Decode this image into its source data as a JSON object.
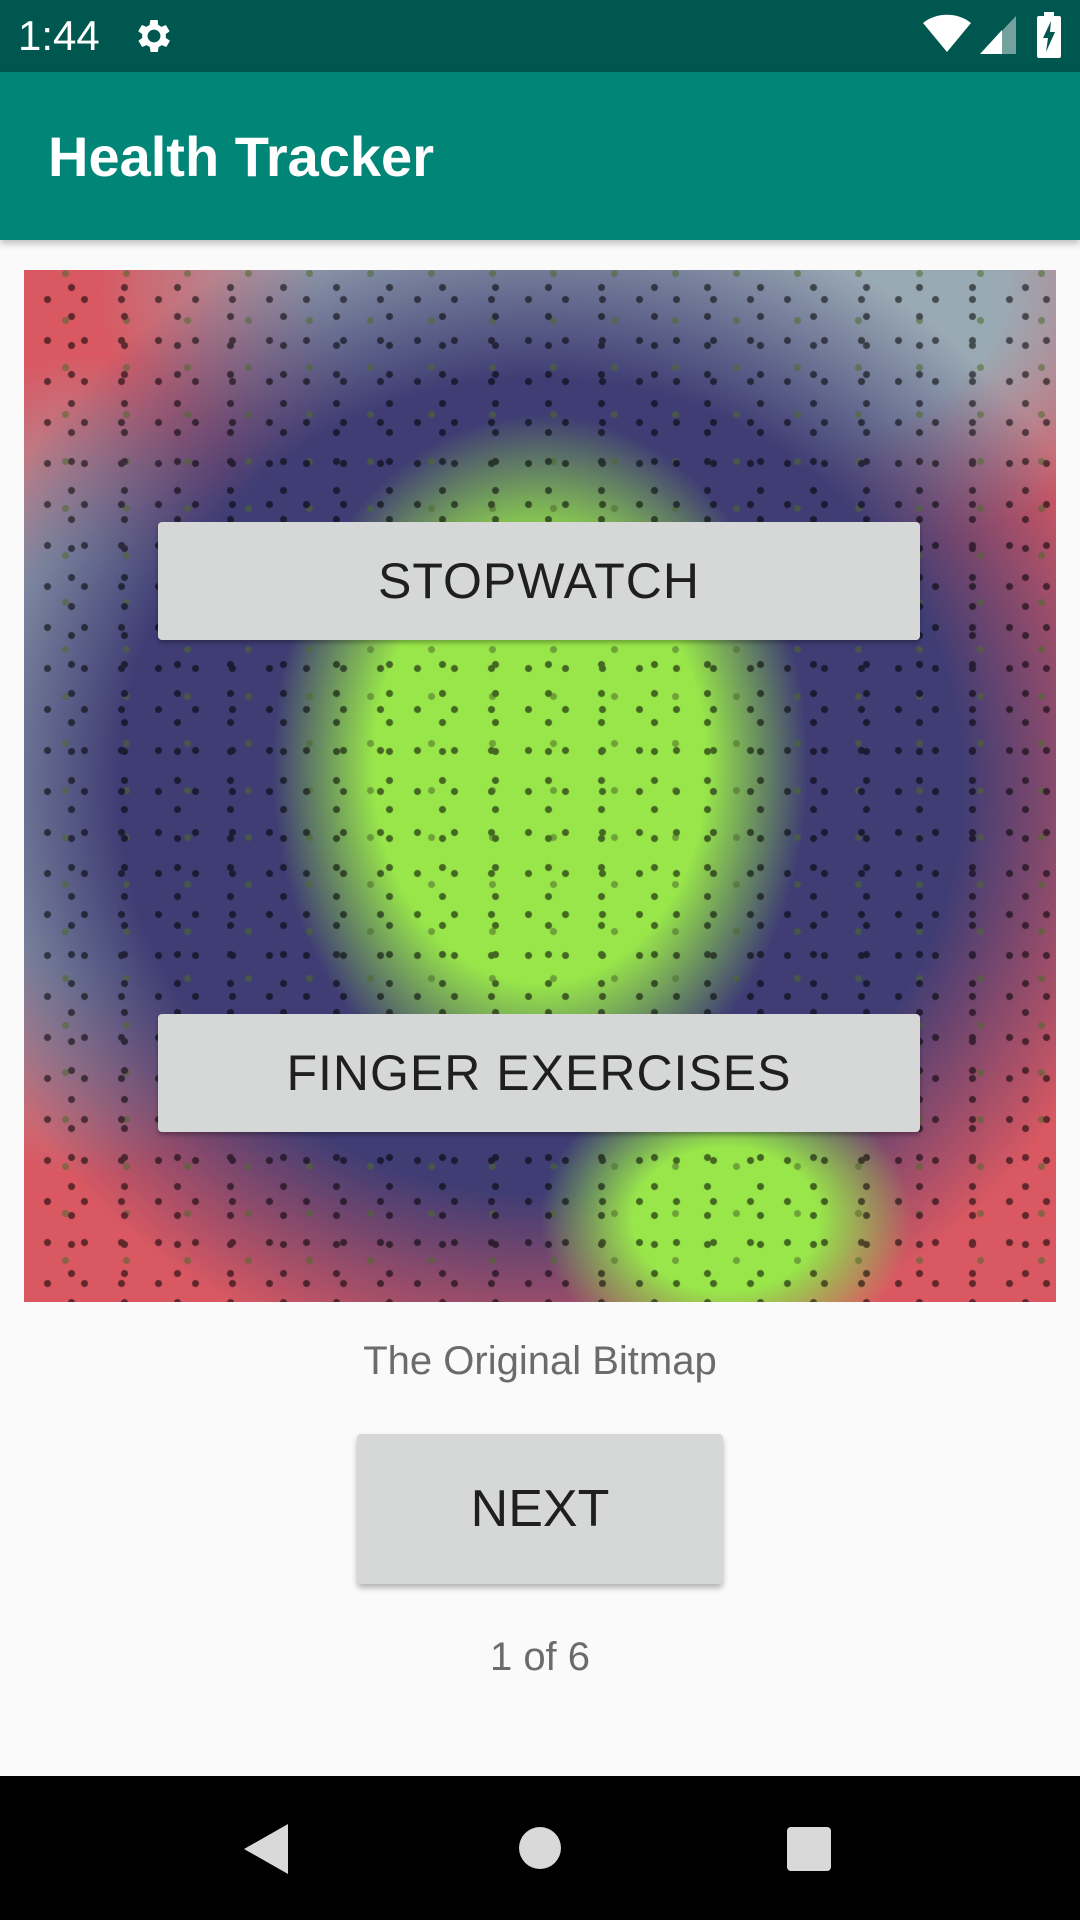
{
  "status_bar": {
    "time": "1:44",
    "icons": [
      "gear-icon",
      "wifi-icon",
      "cell-signal-icon",
      "battery-charging-icon"
    ]
  },
  "app_bar": {
    "title": "Health Tracker",
    "color": "#008577",
    "status_color": "#00574f"
  },
  "bitmap": {
    "colors": [
      "#d95862",
      "#9aaab4",
      "#3f3d74",
      "#98e64a",
      "#000000"
    ]
  },
  "buttons": {
    "stopwatch_label": "STOPWATCH",
    "finger_exercises_label": "FINGER EXERCISES",
    "next_label": "NEXT"
  },
  "caption": "The Original Bitmap",
  "counter": "1 of 6",
  "nav_bar": {
    "icons": [
      "back-icon",
      "home-icon",
      "recents-icon"
    ]
  }
}
